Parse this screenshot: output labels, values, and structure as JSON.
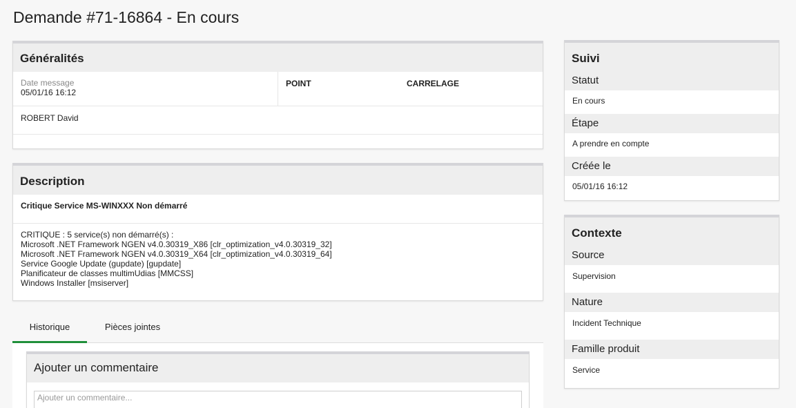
{
  "page": {
    "title": "Demande #71-16864 - En cours"
  },
  "generalites": {
    "heading": "Généralités",
    "date_label": "Date message",
    "date_value": "05/01/16 16:12",
    "point": "POINT",
    "carrelage": "CARRELAGE",
    "person": "ROBERT David"
  },
  "description": {
    "heading": "Description",
    "subject": "Critique Service MS-WINXXX Non démarré",
    "lines": [
      "CRITIQUE : 5 service(s) non démarré(s) :",
      "Microsoft .NET Framework NGEN v4.0.30319_X86 [clr_optimization_v4.0.30319_32]",
      "Microsoft .NET Framework NGEN v4.0.30319_X64 [clr_optimization_v4.0.30319_64]",
      "Service Google Update (gupdate) [gupdate]",
      "Planificateur de classes multimUdias [MMCSS]",
      "Windows Installer [msiserver]"
    ]
  },
  "tabs": [
    {
      "label": "Historique",
      "active": true
    },
    {
      "label": "Pièces jointes",
      "active": false
    }
  ],
  "comment": {
    "heading": "Ajouter un commentaire",
    "placeholder": "Ajouter un commentaire..."
  },
  "suivi": {
    "heading": "Suivi",
    "fields": [
      {
        "label": "Statut",
        "value": "En cours"
      },
      {
        "label": "Étape",
        "value": "A prendre en compte"
      },
      {
        "label": "Créée le",
        "value": "05/01/16 16:12"
      }
    ]
  },
  "contexte": {
    "heading": "Contexte",
    "fields": [
      {
        "label": "Source",
        "value": "Supervision"
      },
      {
        "label": "Nature",
        "value": "Incident Technique"
      },
      {
        "label": "Famille produit",
        "value": "Service"
      }
    ]
  },
  "colors": {
    "tab_active_underline": "#1f8f3a",
    "panel_header_bg": "#eeeeee"
  }
}
